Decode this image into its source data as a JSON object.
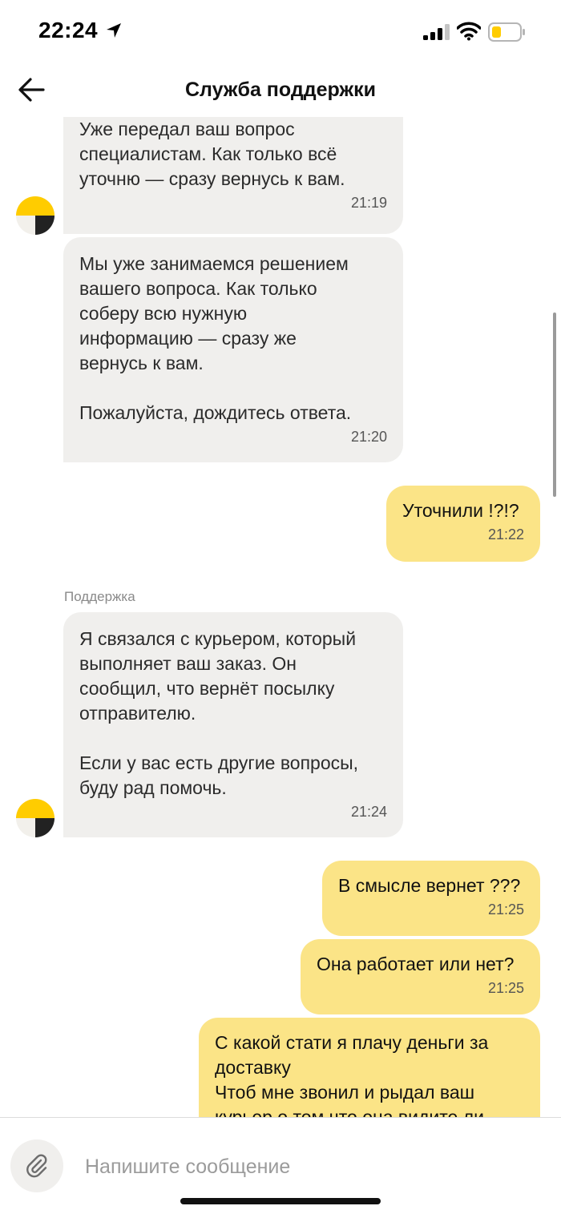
{
  "status_bar": {
    "time": "22:24",
    "icons": [
      "location-arrow-icon",
      "cellular-signal-icon",
      "wifi-icon",
      "battery-low-icon"
    ],
    "battery_color": "#ffcc00"
  },
  "header": {
    "back_icon": "arrow-left-icon",
    "title": "Служба поддержки"
  },
  "messages": [
    {
      "direction": "incoming",
      "text": "Уже передал ваш вопрос\nспециалистам. Как только всё\nуточню — сразу вернусь к вам.",
      "time": "21:19"
    },
    {
      "direction": "incoming",
      "text": "Мы уже занимаемся решением\nвашего вопроса. Как только\nсоберу всю нужную\nинформацию — сразу же\nвернусь к вам.\n\nПожалуйста, дождитесь ответа.",
      "time": "21:20"
    },
    {
      "direction": "outgoing",
      "text": "Уточнили !?!?",
      "time": "21:22"
    },
    {
      "direction": "incoming",
      "sender": "Поддержка",
      "text": "Я связался с курьером, который\nвыполняет ваш заказ. Он\nсообщил, что вернёт посылку\nотправителю.\n\nЕсли у вас есть другие вопросы,\nбуду рад помочь.",
      "time": "21:24"
    },
    {
      "direction": "outgoing",
      "text": "В смысле вернет ???",
      "time": "21:25"
    },
    {
      "direction": "outgoing",
      "text": "Она работает или нет?",
      "time": "21:25"
    },
    {
      "direction": "outgoing",
      "text": "С какой стати я плачу деньги за\nдоставку\nЧтоб мне звонил и рыдал ваш\nкурьер о том что она видите ли"
    }
  ],
  "composer": {
    "attach_icon": "paperclip-icon",
    "placeholder": "Напишите сообщение"
  },
  "colors": {
    "incoming_bubble": "#f0efed",
    "outgoing_bubble": "#fbe487",
    "brand_yellow": "#ffcc00"
  }
}
